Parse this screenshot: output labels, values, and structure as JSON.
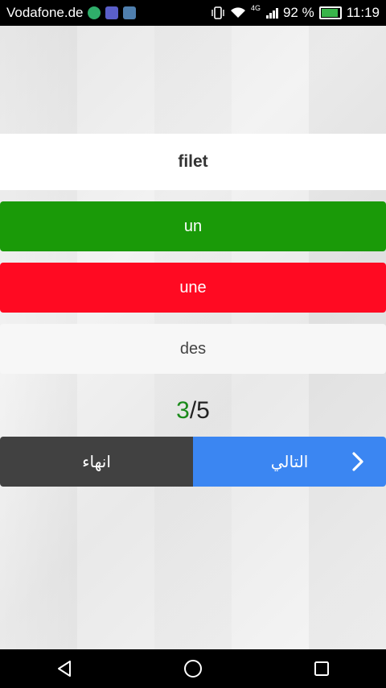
{
  "status_bar": {
    "carrier": "Vodafone.de",
    "network": "4G",
    "battery_percent": "92 %",
    "battery_level": 0.92,
    "time": "11:19"
  },
  "quiz": {
    "word": "filet",
    "options": [
      {
        "label": "un",
        "state": "correct",
        "color": "#1a9a08"
      },
      {
        "label": "une",
        "state": "wrong",
        "color": "#ff0a22"
      },
      {
        "label": "des",
        "state": "neutral",
        "color": "#f7f7f7"
      }
    ],
    "progress": {
      "current": "3",
      "separator": "/",
      "total": "5"
    }
  },
  "actions": {
    "finish_label": "انهاء",
    "next_label": "التالي"
  },
  "icons": {
    "notif1": "app-notification-icon",
    "notif2": "gallery-notification-icon",
    "notif3": "image-notification-icon",
    "next_chevron": "chevron-right-icon",
    "nav_back": "back-triangle-icon",
    "nav_home": "home-circle-icon",
    "nav_recents": "recents-square-icon"
  },
  "colors": {
    "correct": "#1a9a08",
    "wrong": "#ff0a22",
    "next_button": "#3b86f2",
    "finish_button": "#414141",
    "progress_current": "#1a8a1a"
  }
}
